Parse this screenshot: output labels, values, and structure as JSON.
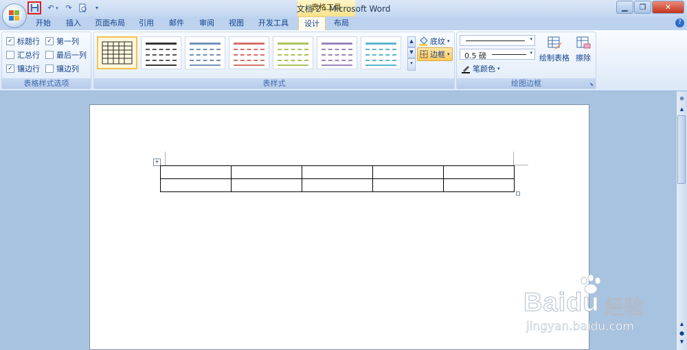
{
  "window": {
    "title": "文档 2 - Microsoft Word",
    "contextual_tab_group": "表格工具"
  },
  "tabs": [
    {
      "label": "开始",
      "active": false
    },
    {
      "label": "插入",
      "active": false
    },
    {
      "label": "页面布局",
      "active": false
    },
    {
      "label": "引用",
      "active": false
    },
    {
      "label": "邮件",
      "active": false
    },
    {
      "label": "审阅",
      "active": false
    },
    {
      "label": "视图",
      "active": false
    },
    {
      "label": "开发工具",
      "active": false
    },
    {
      "label": "设计",
      "active": true
    },
    {
      "label": "布局",
      "active": false
    }
  ],
  "table_style_options": {
    "group_label": "表格样式选项",
    "options": [
      {
        "label": "标题行",
        "checked": true
      },
      {
        "label": "第一列",
        "checked": true
      },
      {
        "label": "汇总行",
        "checked": false
      },
      {
        "label": "最后一列",
        "checked": false
      },
      {
        "label": "镶边行",
        "checked": true
      },
      {
        "label": "镶边列",
        "checked": false
      }
    ]
  },
  "table_styles": {
    "group_label": "表样式",
    "gallery_colors": [
      "#333333",
      "#555555",
      "#6f90b8",
      "#d2706a",
      "#a9c15c",
      "#9a83bd",
      "#5bb3cc"
    ],
    "shading_label": "底纹",
    "border_label": "边框"
  },
  "draw_borders": {
    "group_label": "绘图边框",
    "line_weight": "0.5 磅",
    "pen_color_label": "笔颜色",
    "draw_table_label": "绘制表格",
    "eraser_label": "擦除"
  },
  "watermark": {
    "brand": "Bai",
    "brand_du": "du",
    "brand_cn": "经验",
    "url": "jingyan.baidu.com"
  },
  "colors": {
    "accent_red": "#e21c1c",
    "ribbon_blue": "#15428b",
    "context_yellow": "#f9e28b"
  }
}
